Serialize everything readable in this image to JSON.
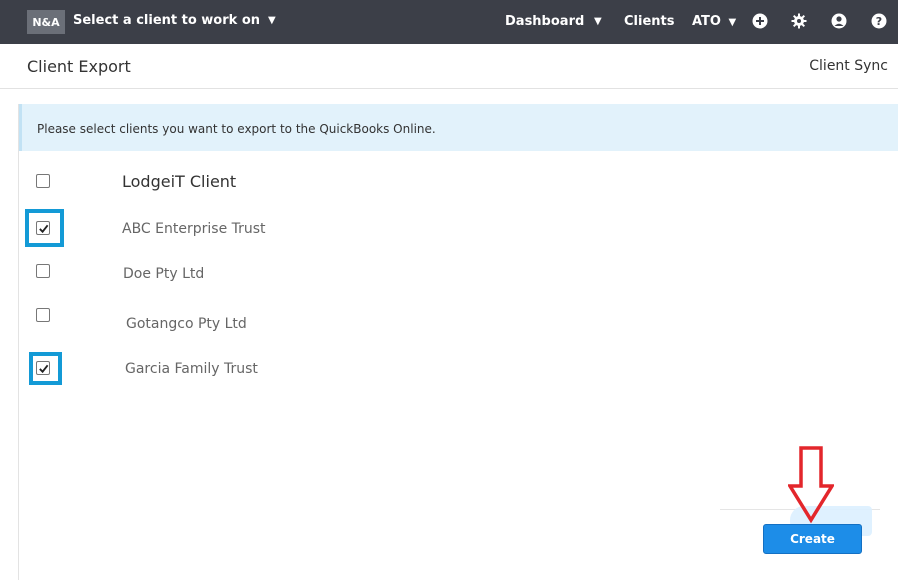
{
  "topbar": {
    "logo": "N&A",
    "client_select": "Select a client to work on",
    "nav": {
      "dashboard": "Dashboard",
      "clients": "Clients",
      "ato": "ATO"
    },
    "icons": [
      "plus-icon",
      "gear-icon",
      "user-icon",
      "help-icon"
    ]
  },
  "header": {
    "title": "Client Export",
    "client_sync": "Client Sync"
  },
  "info": {
    "message": "Please select clients you want to export to the QuickBooks Online."
  },
  "clients": {
    "header_label": "LodgeiT Client",
    "header_checked": false,
    "items": [
      {
        "name": "ABC Enterprise Trust",
        "checked": true
      },
      {
        "name": "Doe Pty Ltd",
        "checked": false
      },
      {
        "name": "Gotangco Pty Ltd",
        "checked": false
      },
      {
        "name": "Garcia Family Trust",
        "checked": true
      }
    ]
  },
  "actions": {
    "create_label": "Create"
  },
  "colors": {
    "topbar": "#3c3f48",
    "highlight": "#139ad6",
    "primary_button": "#1d8de8",
    "annotation_arrow": "#e3262b"
  }
}
